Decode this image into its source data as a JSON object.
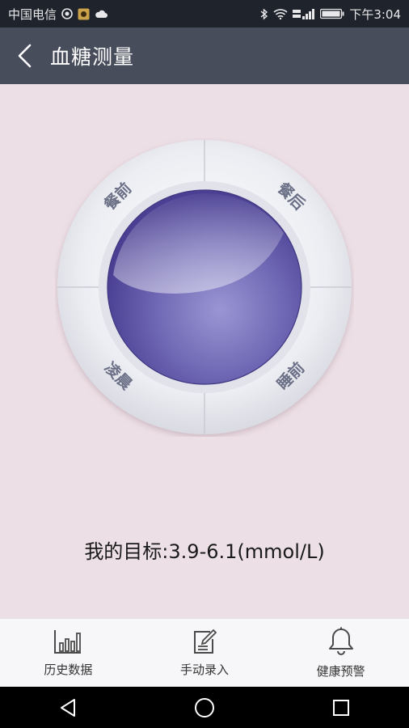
{
  "status_bar": {
    "carrier": "中国电信",
    "time": "下午3:04",
    "icons": [
      "notification-icon",
      "app-icon",
      "cloud-icon",
      "bluetooth-icon",
      "wifi-icon",
      "signal-icon",
      "battery-icon"
    ]
  },
  "header": {
    "back_icon": "chevron-left-icon",
    "title": "血糖测量"
  },
  "dial": {
    "segments": [
      {
        "label": "餐前"
      },
      {
        "label": "餐后"
      },
      {
        "label": "凌晨"
      },
      {
        "label": "睡前"
      }
    ]
  },
  "target_text": "我的目标:3.9-6.1(mmol/L)",
  "bottom_tabs": [
    {
      "label": "历史数据",
      "icon": "bar-chart-icon"
    },
    {
      "label": "手动录入",
      "icon": "edit-icon"
    },
    {
      "label": "健康预警",
      "icon": "bell-icon"
    }
  ],
  "nav_bar": {
    "icons": [
      "back-triangle-icon",
      "home-circle-icon",
      "recents-square-icon"
    ]
  },
  "colors": {
    "status_bar": "#1f232b",
    "app_bar": "#484d5b",
    "background": "#ecdfe5",
    "orb": "#6a62ae",
    "segment_text": "#6a6f86"
  }
}
